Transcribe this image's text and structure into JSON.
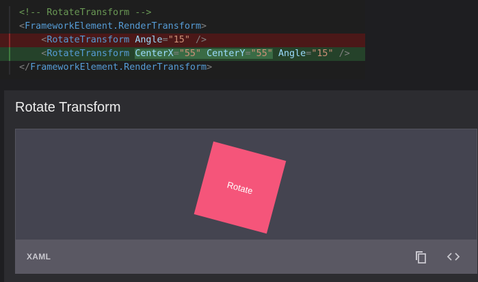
{
  "code_diff": {
    "comment": "<!-- RotateTransform -->",
    "open_tag": "FrameworkElement.RenderTransform",
    "removed_line": {
      "tag": "RotateTransform",
      "attr_angle": "Angle",
      "val_angle": "\"15\""
    },
    "added_line": {
      "tag": "RotateTransform",
      "attr_centerx": "CenterX",
      "val_centerx": "\"55\"",
      "attr_centery": "CenterY",
      "val_centery": "\"55\"",
      "attr_angle": "Angle",
      "val_angle": "\"15\""
    },
    "close_tag": "FrameworkElement.RenderTransform",
    "colors": {
      "removed_bg": "#4b1818",
      "added_bg": "#25422a"
    }
  },
  "sample": {
    "title": "Rotate Transform",
    "box_label": "Rotate",
    "box_color": "#f5557a",
    "rotation_deg": 15,
    "source_label": "XAML",
    "copy_icon": "copy-icon",
    "code_icon": "code-icon"
  }
}
